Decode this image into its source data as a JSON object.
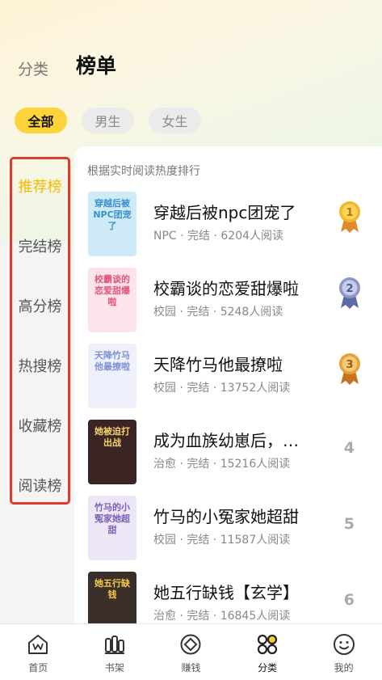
{
  "top_tabs": [
    {
      "label": "分类",
      "active": false
    },
    {
      "label": "榜单",
      "active": true
    }
  ],
  "filters": [
    {
      "label": "全部",
      "active": true
    },
    {
      "label": "男生",
      "active": false
    },
    {
      "label": "女生",
      "active": false
    }
  ],
  "sidebar": [
    {
      "label": "推荐榜",
      "active": true
    },
    {
      "label": "完结榜",
      "active": false
    },
    {
      "label": "高分榜",
      "active": false
    },
    {
      "label": "热搜榜",
      "active": false
    },
    {
      "label": "收藏榜",
      "active": false
    },
    {
      "label": "阅读榜",
      "active": false
    }
  ],
  "list": {
    "subtitle": "根据实时阅读热度排行",
    "books": [
      {
        "rank": "1",
        "title": "穿越后被npc团宠了",
        "meta": "NPC · 完结 · 6204人阅读",
        "cover_text": "穿越后被NPC团宠了",
        "cover_bg": "#cfeaf7",
        "cover_color": "#3b8fd0",
        "medal_color": "#f2b62b"
      },
      {
        "rank": "2",
        "title": "校霸谈的恋爱甜爆啦",
        "meta": "校园 · 完结 · 5248人阅读",
        "cover_text": "校霸谈的恋爱甜爆啦",
        "cover_bg": "#fde4ea",
        "cover_color": "#e0567a",
        "medal_color": "#8c97c8"
      },
      {
        "rank": "3",
        "title": "天降竹马他最撩啦",
        "meta": "校园 · 完结 · 13752人阅读",
        "cover_text": "天降竹马他最撩啦",
        "cover_bg": "#eef1fb",
        "cover_color": "#7f8fd6",
        "medal_color": "#e4a23a"
      },
      {
        "rank": "4",
        "title": "成为血族幼崽后，…",
        "meta": "治愈 · 完结 · 15216人阅读",
        "cover_text": "她被迫打出战",
        "cover_bg": "#3a2424",
        "cover_color": "#f6d36a",
        "medal_color": ""
      },
      {
        "rank": "5",
        "title": "竹马的小冤家她超甜",
        "meta": "校园 · 完结 · 11587人阅读",
        "cover_text": "竹马的小冤家她超甜",
        "cover_bg": "#ece6f6",
        "cover_color": "#7a5fb5",
        "medal_color": ""
      },
      {
        "rank": "6",
        "title": "她五行缺钱【玄学】",
        "meta": "治愈 · 完结 · 16845人阅读",
        "cover_text": "她五行缺钱",
        "cover_bg": "#3b2f2a",
        "cover_color": "#f5c94a",
        "medal_color": ""
      }
    ]
  },
  "bottom_nav": [
    {
      "label": "首页",
      "icon": "home-icon",
      "active": false
    },
    {
      "label": "书架",
      "icon": "bookshelf-icon",
      "active": false
    },
    {
      "label": "赚钱",
      "icon": "earn-icon",
      "active": false
    },
    {
      "label": "分类",
      "icon": "category-icon",
      "active": true
    },
    {
      "label": "我的",
      "icon": "profile-icon",
      "active": false
    }
  ],
  "colors": {
    "accent": "#fcd439",
    "highlight_border": "#e03a2f",
    "active_side": "#f5b800"
  }
}
